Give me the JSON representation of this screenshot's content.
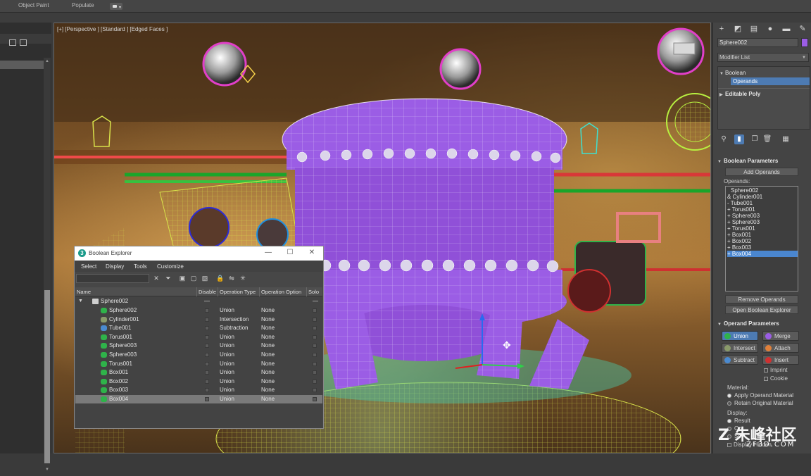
{
  "topbar": {
    "tab_object_paint": "Object Paint",
    "tab_populate": "Populate"
  },
  "viewport": {
    "label": "[+] [Perspective ] [Standard ] [Edged Faces ]"
  },
  "command_panel": {
    "object_name": "Sphere002",
    "object_color": "#9b5de5",
    "modifier_list": "Modifier List",
    "stack": [
      {
        "label": "Boolean",
        "expanded": true
      },
      {
        "label": "Operands",
        "selected": true
      },
      {
        "label": "Editable Poly",
        "expanded": false
      }
    ],
    "boolean_parameters": {
      "title": "Boolean Parameters",
      "add_operands": "Add Operands",
      "operands_label": "Operands:",
      "operands": [
        "Sphere002",
        "& Cylinder001",
        "- Tube001",
        "+ Torus001",
        "+ Sphere003",
        "+ Sphere003",
        "+ Torus001",
        "+ Box001",
        "+ Box002",
        "+ Box003",
        "+ Box004"
      ],
      "selected_operand_index": 10,
      "remove_operands": "Remove Operands",
      "open_explorer": "Open Boolean Explorer"
    },
    "operand_parameters": {
      "title": "Operand Parameters",
      "union": "Union",
      "merge": "Merge",
      "intersect": "Intersect",
      "attach": "Attach",
      "subtract": "Subtract",
      "insert": "Insert",
      "imprint": "Imprint",
      "cookie": "Cookie",
      "material_label": "Material:",
      "apply_operand_material": "Apply Operand Material",
      "retain_original_material": "Retain Original Material",
      "display_label": "Display:",
      "result": "Result",
      "display_truncated_1": "Op",
      "display_truncated_2": "Se",
      "display_truncated_3": "Display Hidden"
    }
  },
  "boolean_explorer": {
    "title": "Boolean Explorer",
    "menu": [
      "Select",
      "Display",
      "Tools",
      "Customize"
    ],
    "columns": {
      "name": "Name",
      "disable": "Disable",
      "operation_type": "Operation Type",
      "operation_option": "Operation Option",
      "solo": "Solo"
    },
    "root": "Sphere002",
    "rows": [
      {
        "name": "Sphere002",
        "type": "Union",
        "option": "None",
        "icon_color": "#2fb34a"
      },
      {
        "name": "Cylinder001",
        "type": "Intersection",
        "option": "None",
        "icon_color": "#8a9a6a"
      },
      {
        "name": "Tube001",
        "type": "Subtraction",
        "option": "None",
        "icon_color": "#4a8ad0"
      },
      {
        "name": "Torus001",
        "type": "Union",
        "option": "None",
        "icon_color": "#2fb34a"
      },
      {
        "name": "Sphere003",
        "type": "Union",
        "option": "None",
        "icon_color": "#2fb34a"
      },
      {
        "name": "Sphere003",
        "type": "Union",
        "option": "None",
        "icon_color": "#2fb34a"
      },
      {
        "name": "Torus001",
        "type": "Union",
        "option": "None",
        "icon_color": "#2fb34a"
      },
      {
        "name": "Box001",
        "type": "Union",
        "option": "None",
        "icon_color": "#2fb34a"
      },
      {
        "name": "Box002",
        "type": "Union",
        "option": "None",
        "icon_color": "#2fb34a"
      },
      {
        "name": "Box003",
        "type": "Union",
        "option": "None",
        "icon_color": "#2fb34a"
      },
      {
        "name": "Box004",
        "type": "Union",
        "option": "None",
        "icon_color": "#2fb34a",
        "selected": true
      }
    ]
  },
  "watermark": {
    "big": "Z 朱峰社区",
    "small": "ZF3D.COM"
  },
  "colors": {
    "accent": "#4d7bb3",
    "purple_object": "#9b5de5"
  }
}
